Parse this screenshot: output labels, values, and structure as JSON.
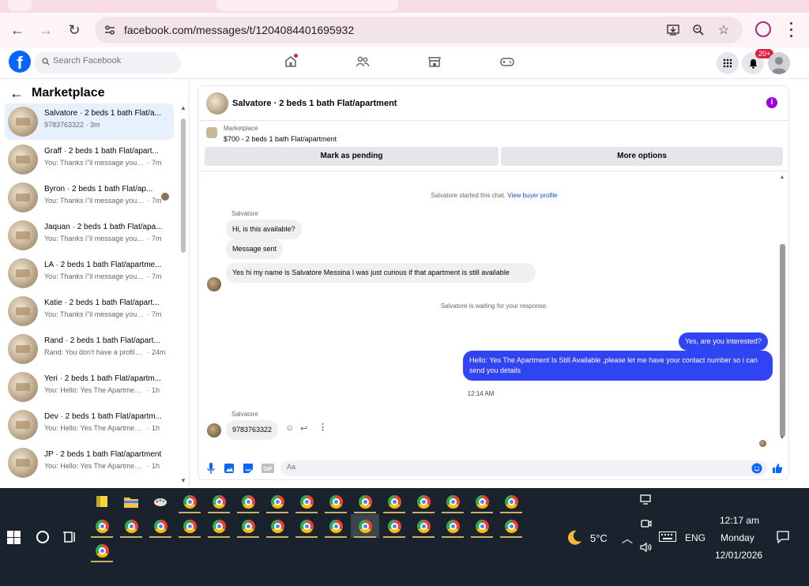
{
  "browser": {
    "url": "facebook.com/messages/t/1204084401695932",
    "back_icon": "←",
    "forward_icon": "→",
    "reload_icon": "↻"
  },
  "facebook": {
    "logo": "f",
    "search_placeholder": "Search Facebook",
    "notification_badge": "20+"
  },
  "sidebar": {
    "title": "Marketplace",
    "conversations": [
      {
        "name": "Salvatore · 2 beds 1 bath Flat/a...",
        "preview": "9783763322",
        "time": " · 3m",
        "active": true
      },
      {
        "name": "Graff · 2 beds 1 bath Flat/apart...",
        "preview": "You: Thanks i\"il message you in a...",
        "time": " · 7m"
      },
      {
        "name": "Byron · 2 beds 1 bath Flat/ap...",
        "preview": "You: Thanks i\"il message you i...",
        "time": " · 7m"
      },
      {
        "name": "Jaquan · 2 beds 1 bath Flat/apa...",
        "preview": "You: Thanks i\"il message you in a...",
        "time": " · 7m"
      },
      {
        "name": "LA · 2 beds 1 bath Flat/apartme...",
        "preview": "You: Thanks i\"il message you in a...",
        "time": " · 7m"
      },
      {
        "name": "Katie · 2 beds 1 bath Flat/apart...",
        "preview": "You: Thanks i\"il message you in a...",
        "time": " · 7m"
      },
      {
        "name": "Rand · 2 beds 1 bath Flat/apart...",
        "preview": "Rand: You don't have a profile p...",
        "time": " · 24m"
      },
      {
        "name": "Yeri · 2 beds 1 bath Flat/apartm...",
        "preview": "You: Hello: Yes The Apartment Is S...",
        "time": " · 1h"
      },
      {
        "name": "Dev · 2 beds 1 bath Flat/apartm...",
        "preview": "You: Hello: Yes The Apartment Is S...",
        "time": " · 1h"
      },
      {
        "name": "JP · 2 beds 1 bath Flat/apartment",
        "preview": "You: Hello: Yes The Apartment Is S...",
        "time": " · 1h"
      }
    ]
  },
  "chat": {
    "title": "Salvatore · 2 beds 1 bath Flat/apartment",
    "listing_category": "Marketplace",
    "listing_desc": "$700 - 2 beds 1 bath Flat/apartment",
    "mark_pending": "Mark as pending",
    "more_options": "More options",
    "started_text": "Salvatore started this chat.",
    "view_profile": "View buyer profile",
    "sender_name": "Salvatore",
    "msg1": "Hi, is this available?",
    "msg2": "Message sent",
    "msg3": "Yes hi my name is Salvatore Messina I was just curious if that apartment is still available",
    "waiting": "Salvatore is waiting for your response.",
    "out1": "Yes, are you interested?",
    "out2": "Hello: Yes The Apartment Is Still Available ,please let me have your contact number so i can send you details",
    "time": "12:14 AM",
    "sender_name2": "Salvatore",
    "msg4": "9783763322",
    "composer_placeholder": "Aa"
  },
  "taskbar": {
    "temperature": "5°C",
    "language": "ENG",
    "time": "12:17 am",
    "day": "Monday",
    "date": "12/01/2026"
  },
  "colors": {
    "fb_blue": "#0866ff",
    "outgoing_bubble": "#3144f4",
    "taskbar": "#1a232d"
  }
}
